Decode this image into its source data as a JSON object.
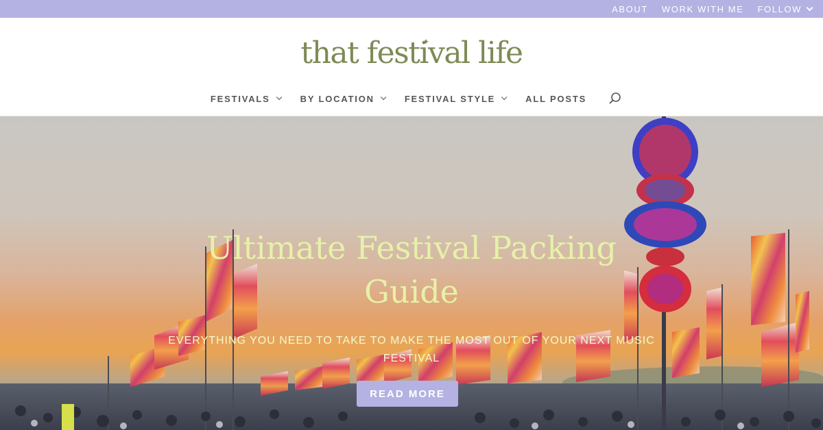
{
  "topbar": {
    "links": [
      "ABOUT",
      "WORK WITH ME",
      "FOLLOW"
    ]
  },
  "brand": {
    "logo_text": "that festival life",
    "color": "#7d8a56"
  },
  "nav": {
    "items": [
      "FESTIVALS",
      "BY LOCATION",
      "FESTIVAL STYLE",
      "ALL POSTS"
    ],
    "search_icon": "search-icon"
  },
  "hero": {
    "title": "Ultimate Festival Packing Guide",
    "subtitle": "EVERYTHING YOU NEED TO TAKE TO MAKE THE MOST OUT OF YOUR NEXT MUSIC FESTIVAL",
    "cta_label": "READ MORE"
  },
  "colors": {
    "accent": "#b4b2e2",
    "title": "#e6f2a8"
  }
}
